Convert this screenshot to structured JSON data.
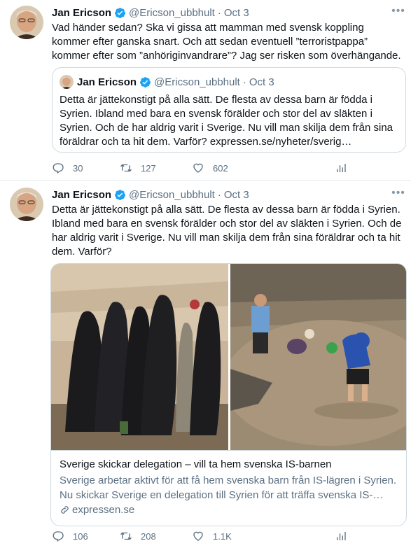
{
  "colors": {
    "accent": "#1da1f2",
    "text": "#0f1419",
    "secondary": "#5b7083",
    "border": "#cfd9de"
  },
  "tweets": [
    {
      "author": {
        "name": "Jan Ericson",
        "handle": "@Ericson_ubbhult",
        "date": "Oct 3",
        "verified": true
      },
      "separator": "·",
      "text": "Vad händer sedan? Ska vi gissa att mamman med svensk koppling kommer efter ganska snart. Och att sedan eventuell ”terroristpappa” kommer efter som ”anhöriginvandrare”? Jag ser risken som överhängande.",
      "quote": {
        "author": {
          "name": "Jan Ericson",
          "handle": "@Ericson_ubbhult",
          "date": "Oct 3"
        },
        "text": "Detta är jättekonstigt på alla sätt. De flesta av dessa barn är födda i Syrien. Ibland med bara en svensk förälder och stor del av släkten i Syrien. Och de har aldrig varit i Sverige. Nu vill man skilja dem från sina föräldrar och ta hit dem. Varför?  expressen.se/nyheter/sverig…"
      },
      "stats": {
        "replies": "30",
        "retweets": "127",
        "likes": "602"
      }
    },
    {
      "author": {
        "name": "Jan Ericson",
        "handle": "@Ericson_ubbhult",
        "date": "Oct 3",
        "verified": true
      },
      "separator": "·",
      "text": "Detta är jättekonstigt på alla sätt. De flesta av dessa barn är födda i Syrien. Ibland med bara en svensk förälder och stor del av släkten i Syrien. Och de har aldrig varit i Sverige. Nu vill man skilja dem från sina föräldrar och ta hit dem. Varför?",
      "card": {
        "title": "Sverige skickar delegation – vill ta hem svenska IS-barnen",
        "description": "Sverige arbetar aktivt för att få hem svenska barn från IS-lägren i Syrien. Nu skickar Sverige en delegation till Syrien för att träffa svenska IS-…",
        "domain": "expressen.se"
      },
      "stats": {
        "replies": "106",
        "retweets": "208",
        "likes": "1.1K"
      }
    }
  ],
  "icons": {
    "reply": "reply-icon",
    "retweet": "retweet-icon",
    "like": "heart-icon",
    "share": "analytics-icon",
    "more": "more-icon",
    "verified": "verified-badge-icon",
    "link": "link-icon"
  }
}
